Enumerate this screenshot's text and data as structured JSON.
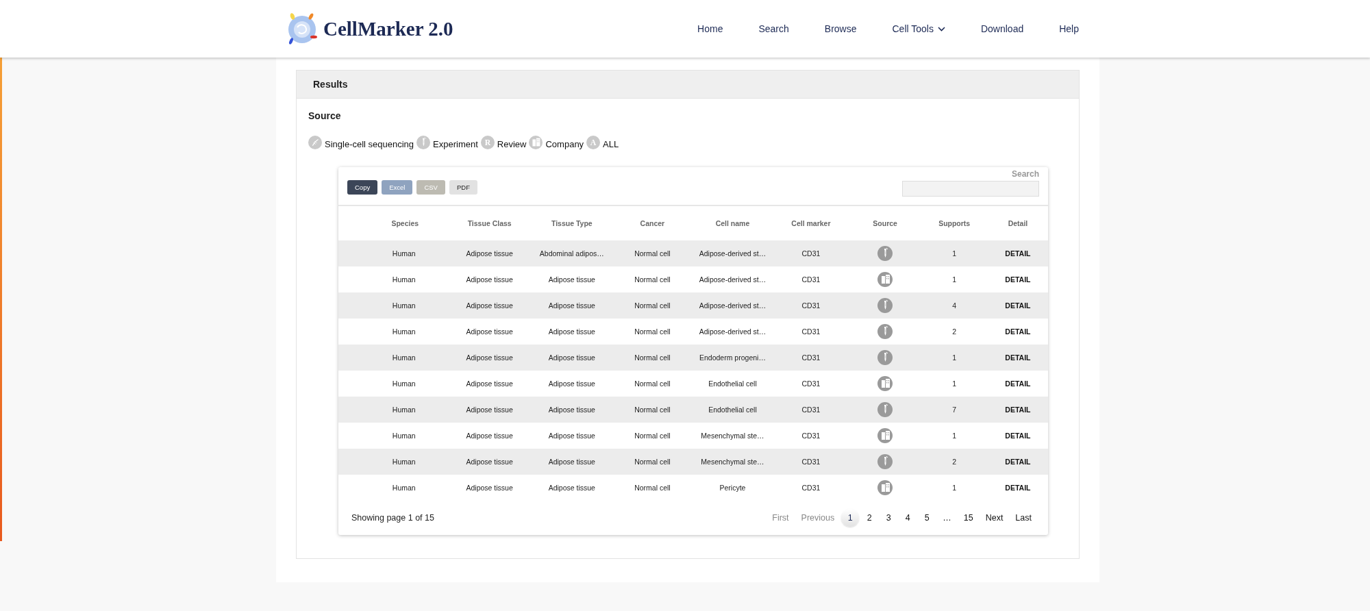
{
  "header": {
    "logo_text": "CellMarker 2.0",
    "nav": [
      {
        "label": "Home",
        "dropdown": false
      },
      {
        "label": "Search",
        "dropdown": false
      },
      {
        "label": "Browse",
        "dropdown": false
      },
      {
        "label": "Cell Tools",
        "dropdown": true
      },
      {
        "label": "Download",
        "dropdown": false
      },
      {
        "label": "Help",
        "dropdown": false
      }
    ]
  },
  "panel": {
    "title": "Results",
    "source_heading": "Source",
    "source_filters": [
      {
        "kind": "sequencing",
        "label": "Single-cell sequencing"
      },
      {
        "kind": "experiment",
        "label": "Experiment"
      },
      {
        "kind": "letter",
        "glyph": "R",
        "label": "Review"
      },
      {
        "kind": "company",
        "label": "Company"
      },
      {
        "kind": "letter",
        "glyph": "A",
        "label": "ALL"
      }
    ],
    "table": {
      "export_buttons": [
        {
          "kind": "copy",
          "label": "Copy"
        },
        {
          "kind": "excel",
          "label": "Excel"
        },
        {
          "kind": "csv",
          "label": "CSV"
        },
        {
          "kind": "pdf",
          "label": "PDF"
        }
      ],
      "search_label": "Search",
      "columns": [
        "Species",
        "Tissue Class",
        "Tissue Type",
        "Cancer",
        "Cell name",
        "Cell marker",
        "Source",
        "Supports",
        "Detail"
      ],
      "rows": [
        {
          "species": "Human",
          "tissue_class": "Adipose tissue",
          "tissue_type": "Abdominal adipos…",
          "cancer": "Normal cell",
          "cell_name": "Adipose-derived st…",
          "marker": "CD31",
          "kind": "experiment",
          "supports": "1",
          "detail": "DETAIL"
        },
        {
          "species": "Human",
          "tissue_class": "Adipose tissue",
          "tissue_type": "Adipose tissue",
          "cancer": "Normal cell",
          "cell_name": "Adipose-derived st…",
          "marker": "CD31",
          "kind": "company",
          "supports": "1",
          "detail": "DETAIL"
        },
        {
          "species": "Human",
          "tissue_class": "Adipose tissue",
          "tissue_type": "Adipose tissue",
          "cancer": "Normal cell",
          "cell_name": "Adipose-derived st…",
          "marker": "CD31",
          "kind": "experiment",
          "supports": "4",
          "detail": "DETAIL"
        },
        {
          "species": "Human",
          "tissue_class": "Adipose tissue",
          "tissue_type": "Adipose tissue",
          "cancer": "Normal cell",
          "cell_name": "Adipose-derived st…",
          "marker": "CD31",
          "kind": "experiment",
          "supports": "2",
          "detail": "DETAIL"
        },
        {
          "species": "Human",
          "tissue_class": "Adipose tissue",
          "tissue_type": "Adipose tissue",
          "cancer": "Normal cell",
          "cell_name": "Endoderm progeni…",
          "marker": "CD31",
          "kind": "experiment",
          "supports": "1",
          "detail": "DETAIL"
        },
        {
          "species": "Human",
          "tissue_class": "Adipose tissue",
          "tissue_type": "Adipose tissue",
          "cancer": "Normal cell",
          "cell_name": "Endothelial cell",
          "marker": "CD31",
          "kind": "company",
          "supports": "1",
          "detail": "DETAIL"
        },
        {
          "species": "Human",
          "tissue_class": "Adipose tissue",
          "tissue_type": "Adipose tissue",
          "cancer": "Normal cell",
          "cell_name": "Endothelial cell",
          "marker": "CD31",
          "kind": "experiment",
          "supports": "7",
          "detail": "DETAIL"
        },
        {
          "species": "Human",
          "tissue_class": "Adipose tissue",
          "tissue_type": "Adipose tissue",
          "cancer": "Normal cell",
          "cell_name": "Mesenchymal ste…",
          "marker": "CD31",
          "kind": "company",
          "supports": "1",
          "detail": "DETAIL"
        },
        {
          "species": "Human",
          "tissue_class": "Adipose tissue",
          "tissue_type": "Adipose tissue",
          "cancer": "Normal cell",
          "cell_name": "Mesenchymal ste…",
          "marker": "CD31",
          "kind": "experiment",
          "supports": "2",
          "detail": "DETAIL"
        },
        {
          "species": "Human",
          "tissue_class": "Adipose tissue",
          "tissue_type": "Adipose tissue",
          "cancer": "Normal cell",
          "cell_name": "Pericyte",
          "marker": "CD31",
          "kind": "company",
          "supports": "1",
          "detail": "DETAIL"
        }
      ],
      "info": "Showing page 1 of 15",
      "pagination": [
        {
          "label": "First",
          "selected": false,
          "disabled": true
        },
        {
          "label": "Previous",
          "selected": false,
          "disabled": true
        },
        {
          "label": "1",
          "selected": true,
          "disabled": false
        },
        {
          "label": "2",
          "selected": false,
          "disabled": false
        },
        {
          "label": "3",
          "selected": false,
          "disabled": false
        },
        {
          "label": "4",
          "selected": false,
          "disabled": false
        },
        {
          "label": "5",
          "selected": false,
          "disabled": false
        },
        {
          "label": "…",
          "selected": false,
          "disabled": false
        },
        {
          "label": "15",
          "selected": false,
          "disabled": false
        },
        {
          "label": "Next",
          "selected": false,
          "disabled": false
        },
        {
          "label": "Last",
          "selected": false,
          "disabled": false
        }
      ]
    }
  }
}
